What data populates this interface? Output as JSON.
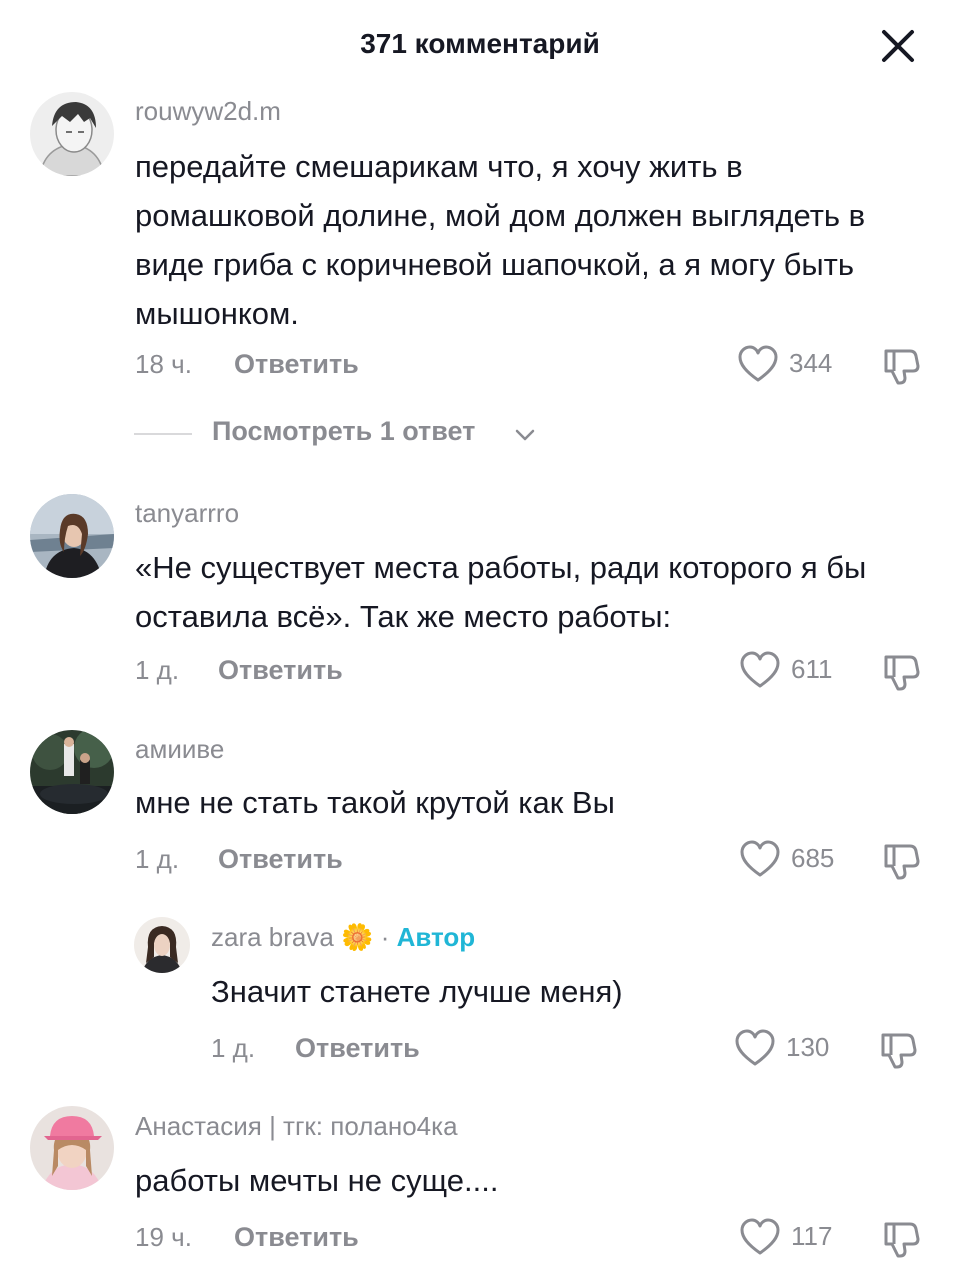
{
  "header": {
    "title": "371 комментарий"
  },
  "view_replies_label": "Посмотреть 1 ответ",
  "comments": [
    {
      "username": "rouwyw2d.m",
      "text": "передайте смешарикам что, я хочу жить в ромашковой долине, мой дом должен выглядеть в виде гриба с коричневой шапочкой, а я могу быть мышонком.",
      "time": "18 ч.",
      "reply_label": "Ответить",
      "likes": "344"
    },
    {
      "username": "tanyarrro",
      "text": "«Не существует места работы, ради которого я бы оставила всё». Так же место работы:",
      "time": "1 д.",
      "reply_label": "Ответить",
      "likes": "611"
    },
    {
      "username": "амииве",
      "text": "мне не стать такой крутой как Вы",
      "time": "1 д.",
      "reply_label": "Ответить",
      "likes": "685"
    },
    {
      "username": "zara brava",
      "emoji": "🌼",
      "separator": "·",
      "badge": "Автор",
      "text": "Значит станете лучше меня)",
      "time": "1 д.",
      "reply_label": "Ответить",
      "likes": "130"
    },
    {
      "username": "Анастасия | тгк: полано4ка",
      "text": "работы мечты не суще....",
      "time": "19 ч.",
      "reply_label": "Ответить",
      "likes": "117"
    }
  ],
  "icons": {
    "close": "close-icon",
    "like": "heart-icon",
    "dislike": "thumbs-down-icon",
    "expand": "chevron-down-icon"
  },
  "colors": {
    "text": "#161823",
    "secondary": "#8a8b91",
    "author_badge": "#20b6d6"
  }
}
